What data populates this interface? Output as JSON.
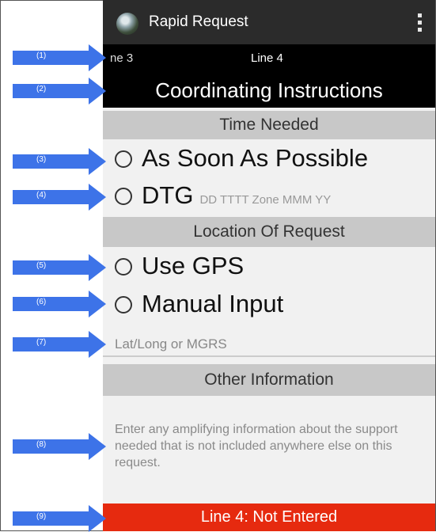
{
  "app": {
    "title": "Rapid Request"
  },
  "tabs": {
    "previous": "ne 3",
    "current": "Line 4"
  },
  "section": {
    "header": "Coordinating Instructions"
  },
  "time_needed": {
    "title": "Time Needed",
    "options": [
      {
        "label": "As Soon As Possible",
        "selected": false
      },
      {
        "label": "DTG",
        "hint": "DD TTTT Zone MMM YY",
        "selected": false
      }
    ]
  },
  "location": {
    "title": "Location Of Request",
    "options": [
      {
        "label": "Use GPS",
        "selected": false
      },
      {
        "label": "Manual Input",
        "selected": false
      }
    ],
    "input_placeholder": "Lat/Long or MGRS"
  },
  "other": {
    "title": "Other Information",
    "placeholder": "Enter any amplifying information about the support needed that is not included anywhere else on this request."
  },
  "status": {
    "text": "Line 4: Not Entered",
    "color": "#e62a0f"
  },
  "callouts": [
    "(1)",
    "(2)",
    "(3)",
    "(4)",
    "(5)",
    "(6)",
    "(7)",
    "(8)",
    "(9)"
  ],
  "colors": {
    "callout": "#3d73e8",
    "actionbar": "#2b2b2b",
    "subheader": "#c8c8c8"
  },
  "icons": {
    "app": "app-globe-icon",
    "overflow": "overflow-menu-icon"
  }
}
